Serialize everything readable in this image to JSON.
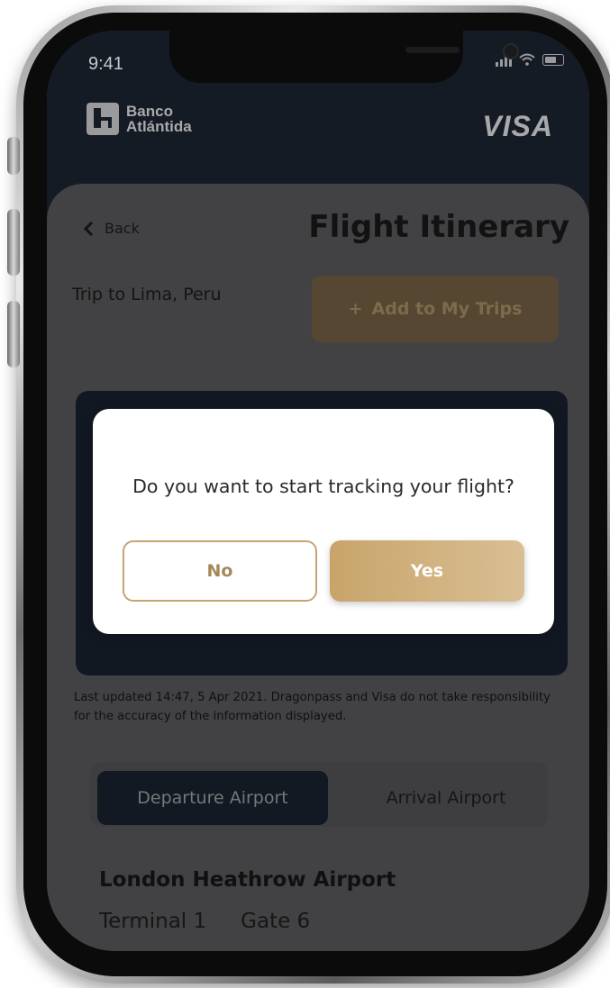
{
  "status_bar": {
    "time": "9:41"
  },
  "header": {
    "bank_name_line1": "Banco",
    "bank_name_line2": "Atlántida",
    "card_brand": "VISA"
  },
  "nav": {
    "back_label": "Back",
    "page_title": "Flight Itinerary"
  },
  "trip": {
    "name": "Trip to Lima, Peru",
    "add_button_icon": "+",
    "add_button_label": "Add to My Trips"
  },
  "modal": {
    "question": "Do you want to start tracking your flight?",
    "no_label": "No",
    "yes_label": "Yes"
  },
  "disclaimer": "Last updated 14:47, 5 Apr 2021. Dragonpass and Visa do not take responsibility for the accuracy of the information displayed.",
  "airport_tabs": {
    "departure_label": "Departure Airport",
    "arrival_label": "Arrival Airport",
    "active": "Departure Airport"
  },
  "airport": {
    "name": "London Heathrow Airport",
    "terminal": "Terminal 1",
    "gate": "Gate 6"
  },
  "icons": [
    "chevron-left-icon",
    "plus-icon",
    "signal-icon",
    "wifi-icon",
    "battery-icon",
    "bank-logo-icon"
  ],
  "colors": {
    "accent_gold": "#c8a46a",
    "dark_navy": "#151b25",
    "modal_bg": "#ffffff"
  }
}
